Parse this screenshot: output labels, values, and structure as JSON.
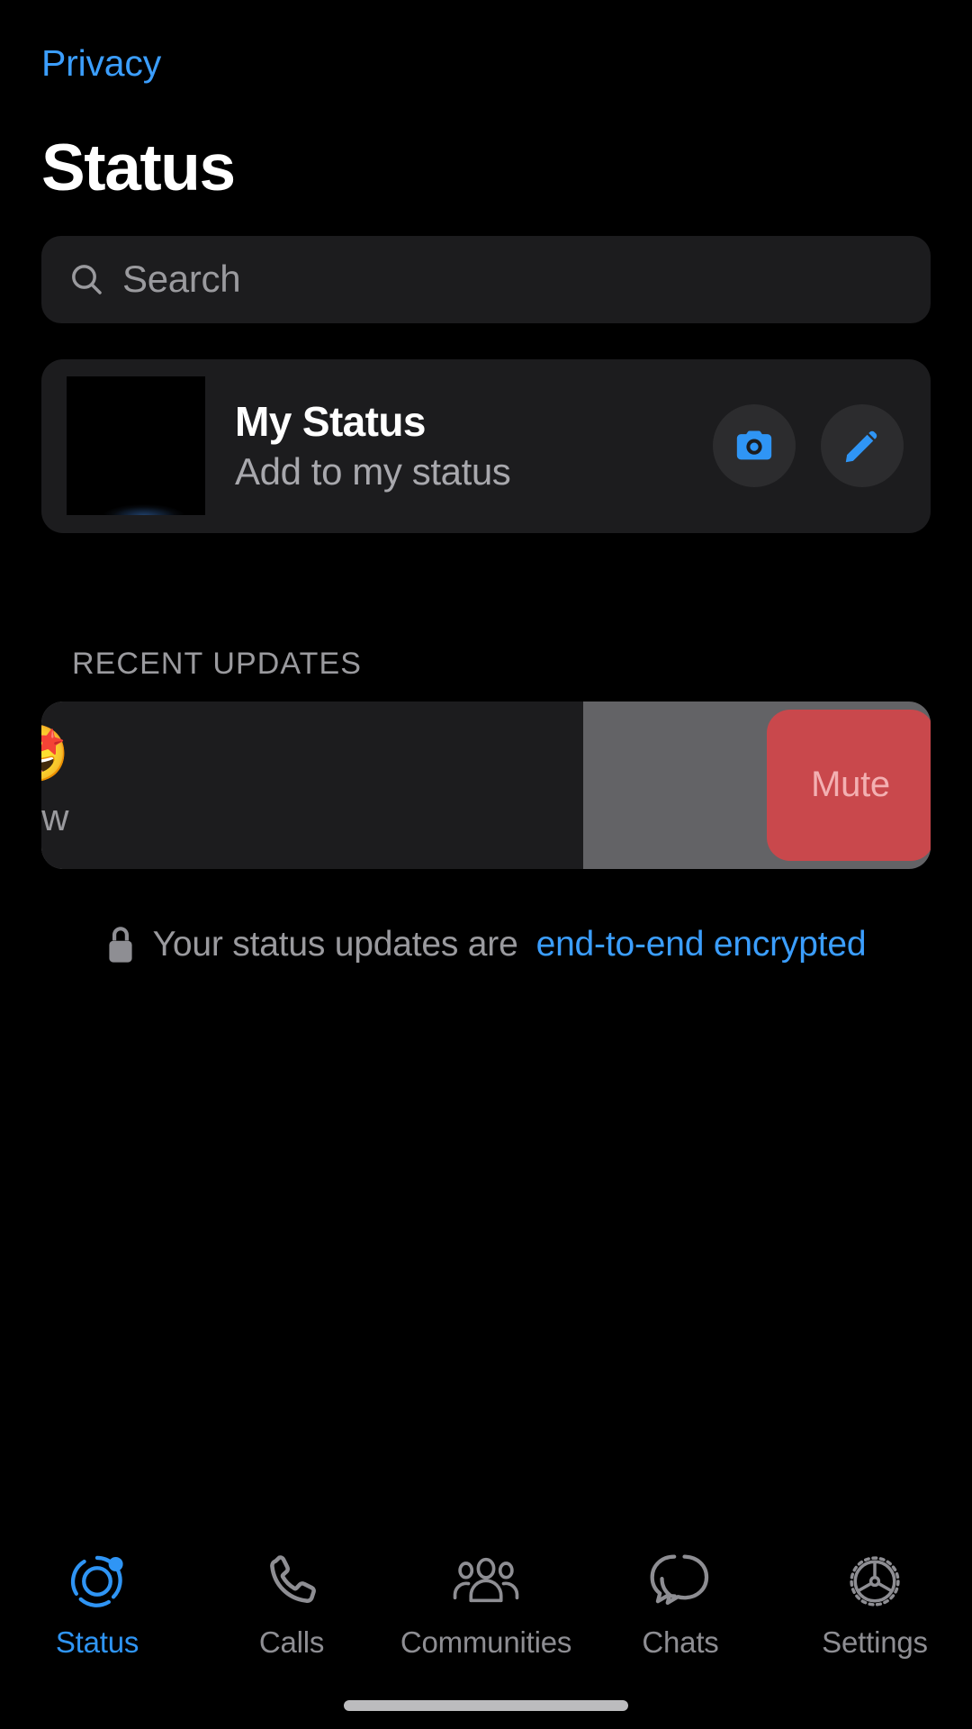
{
  "header": {
    "privacy_link": "Privacy",
    "title": "Status"
  },
  "search": {
    "placeholder": "Search",
    "value": "",
    "icon": "search-icon"
  },
  "my_status": {
    "title": "My Status",
    "subtitle": "Add to my status",
    "camera_button_icon": "camera-icon",
    "edit_button_icon": "pencil-icon"
  },
  "recent_updates": {
    "section_label": "RECENT UPDATES",
    "items": [
      {
        "emoji": "🤩",
        "time": "now",
        "swipe_action_label": "Mute"
      }
    ]
  },
  "encryption": {
    "lock_icon": "lock-icon",
    "text": "Your status updates are",
    "link_text": "end-to-end encrypted"
  },
  "tabs": [
    {
      "label": "Status",
      "icon": "status-icon",
      "active": true
    },
    {
      "label": "Calls",
      "icon": "phone-icon",
      "active": false
    },
    {
      "label": "Communities",
      "icon": "people-group-icon",
      "active": false
    },
    {
      "label": "Chats",
      "icon": "chat-bubbles-icon",
      "active": false
    },
    {
      "label": "Settings",
      "icon": "gear-icon",
      "active": false
    }
  ],
  "colors": {
    "accent_blue": "#3b9eff",
    "tab_active_blue": "#2f95f5",
    "card_bg": "#1c1c1e",
    "secondary_text": "#9a9a9e",
    "mute_red": "#c9484c",
    "mute_label": "#f3b0b2",
    "swipe_track_gray": "#636366",
    "background": "#000000"
  }
}
